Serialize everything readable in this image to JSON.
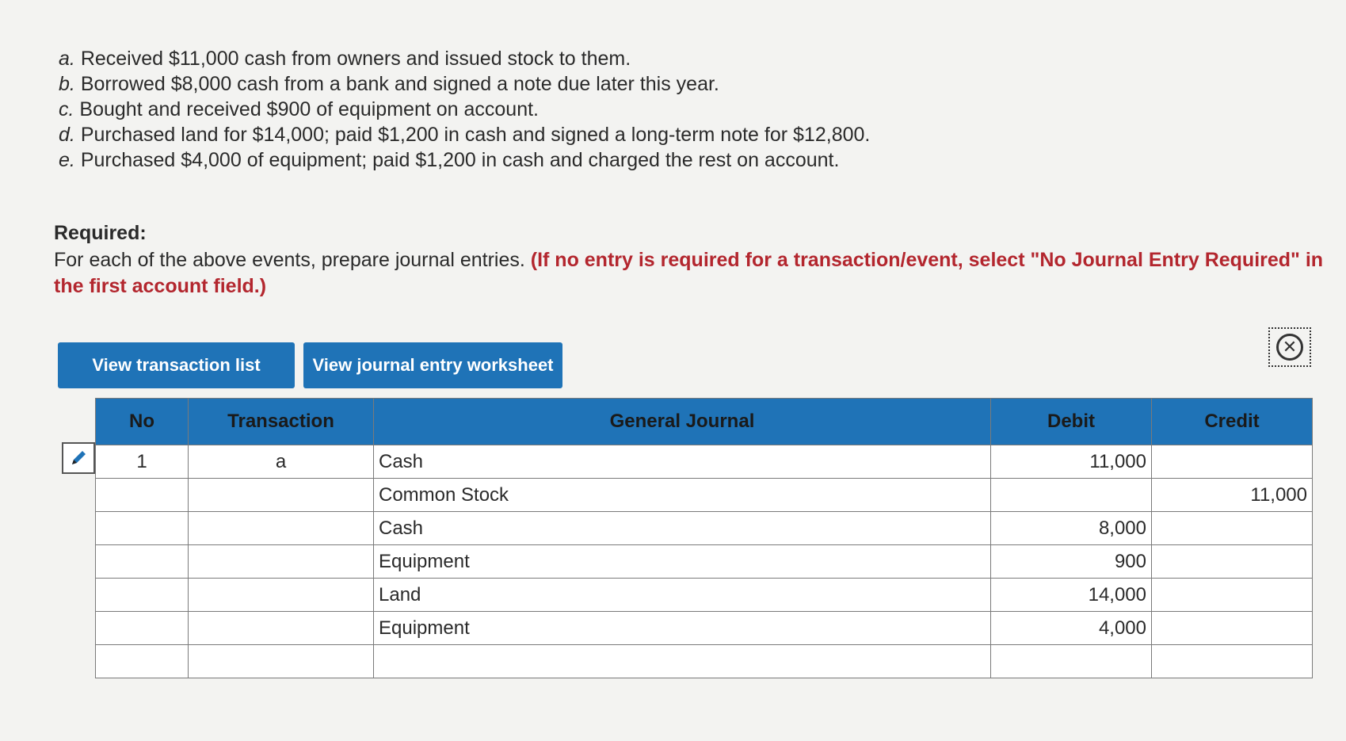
{
  "events": [
    {
      "letter": "a.",
      "text": "Received $11,000 cash from owners and issued stock to them."
    },
    {
      "letter": "b.",
      "text": "Borrowed $8,000 cash from a bank and signed a note due later this year."
    },
    {
      "letter": "c.",
      "text": "Bought and received $900 of equipment on account."
    },
    {
      "letter": "d.",
      "text": "Purchased land for $14,000; paid $1,200 in cash and signed a long-term note for $12,800."
    },
    {
      "letter": "e.",
      "text": "Purchased $4,000 of equipment; paid $1,200 in cash and charged the rest on account."
    }
  ],
  "required": {
    "title": "Required:",
    "text": "For each of the above events, prepare journal entries. ",
    "emphasis": "(If no entry is required for a transaction/event, select \"No Journal Entry Required\" in the first account field.)"
  },
  "buttons": {
    "transaction_list": "View transaction list",
    "journal_worksheet": "View journal entry worksheet"
  },
  "icons": {
    "close": "close-circle-icon",
    "edit": "pencil-icon"
  },
  "colors": {
    "accent": "#1f73b7",
    "emphasis": "#b3262e"
  },
  "table": {
    "headers": {
      "no": "No",
      "transaction": "Transaction",
      "journal": "General Journal",
      "debit": "Debit",
      "credit": "Credit"
    },
    "rows": [
      {
        "no": "1",
        "transaction": "a",
        "account": "Cash",
        "debit": "11,000",
        "credit": "",
        "indent": false
      },
      {
        "no": "",
        "transaction": "",
        "account": "Common Stock",
        "debit": "",
        "credit": "11,000",
        "indent": true
      },
      {
        "no": "",
        "transaction": "",
        "account": "Cash",
        "debit": "8,000",
        "credit": "",
        "indent": false
      },
      {
        "no": "",
        "transaction": "",
        "account": "Equipment",
        "debit": "900",
        "credit": "",
        "indent": false
      },
      {
        "no": "",
        "transaction": "",
        "account": "Land",
        "debit": "14,000",
        "credit": "",
        "indent": false
      },
      {
        "no": "",
        "transaction": "",
        "account": "Equipment",
        "debit": "4,000",
        "credit": "",
        "indent": false
      },
      {
        "no": "",
        "transaction": "",
        "account": "",
        "debit": "",
        "credit": "",
        "indent": false
      }
    ]
  }
}
